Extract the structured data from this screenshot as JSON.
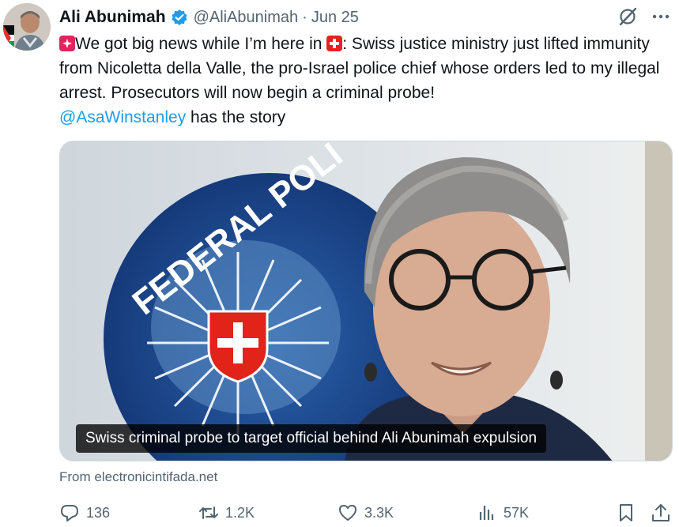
{
  "author": {
    "display_name": "Ali Abunimah",
    "handle": "@AliAbunimah",
    "date": "Jun 25",
    "verified": true
  },
  "header_icons": [
    "grok-icon",
    "more-options-icon"
  ],
  "tweet": {
    "line1_pre": "We got big news while I’m here in ",
    "line1_post": ": Swiss justice ministry just lifted immunity from Nicoletta della Valle, the pro-Israel police chief whose orders led to my illegal arrest. Prosecutors will now begin a criminal probe!",
    "mention": "@AsaWinstanley",
    "tail": " has the story",
    "emojis": [
      "rotating-light-emoji",
      "swiss-flag-emoji"
    ]
  },
  "card": {
    "caption": "Swiss criminal probe to target official behind Ali Abunimah expulsion",
    "logo_text": "FEDERAL POLI",
    "source": "From electronicintifada.net"
  },
  "stats": {
    "replies": "136",
    "reposts": "1.2K",
    "likes": "3.3K",
    "views": "57K"
  },
  "colors": {
    "text": "#0f1419",
    "secondary": "#536471",
    "link": "#1d9bf0",
    "verified": "#1d9bf0",
    "swiss_red": "#e2231a"
  }
}
